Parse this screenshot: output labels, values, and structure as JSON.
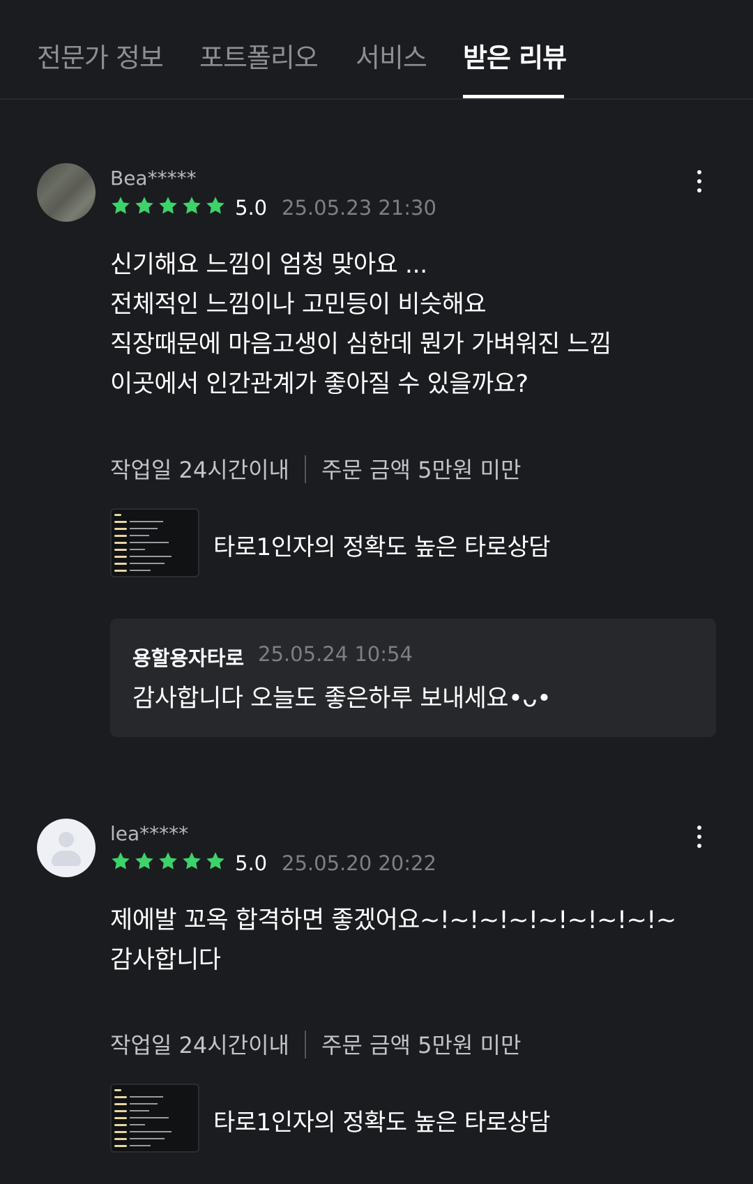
{
  "tabs": [
    {
      "label": "전문가 정보"
    },
    {
      "label": "포트폴리오"
    },
    {
      "label": "서비스"
    },
    {
      "label": "받은 리뷰",
      "active": true
    }
  ],
  "colors": {
    "background": "#1b1c1f",
    "star": "#3dd36b",
    "reply_bg": "#27282c"
  },
  "reviews": [
    {
      "user": "Bea*****",
      "rating": 5,
      "score": "5.0",
      "date": "25.05.23 21:30",
      "lines": [
        "신기해요 느낌이 엄청 맞아요 ...",
        "전체적인 느낌이나 고민등이 비슷해요",
        "직장때문에 마음고생이 심한데 뭔가 가벼워진 느낌",
        "이곳에서 인간관계가 좋아질 수 있을까요?"
      ],
      "work_period": "작업일 24시간이내",
      "order_amount": "주문 금액 5만원 미만",
      "service_title": "타로1인자의 정확도 높은 타로상담",
      "reply": {
        "name": "용할용자타로",
        "date": "25.05.24 10:54",
        "text": "감사합니다 오늘도 좋은하루 보내세요•ᴗ•"
      }
    },
    {
      "user": "lea*****",
      "rating": 5,
      "score": "5.0",
      "date": "25.05.20 20:22",
      "lines": [
        "제에발 꼬옥 합격하면 좋겠어요~!~!~!~!~!~!~!~!~",
        "감사합니다"
      ],
      "work_period": "작업일 24시간이내",
      "order_amount": "주문 금액 5만원 미만",
      "service_title": "타로1인자의 정확도 높은 타로상담"
    }
  ],
  "icons": {
    "more": "more-vertical-icon",
    "star": "star-icon",
    "avatar": "default-avatar-icon"
  }
}
